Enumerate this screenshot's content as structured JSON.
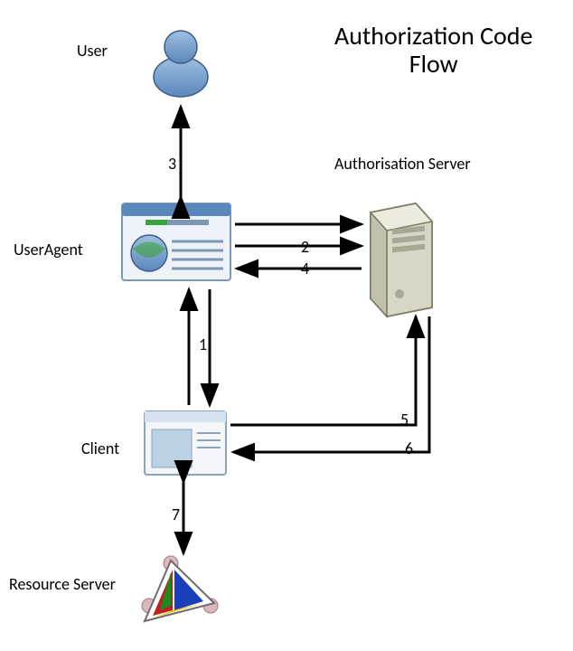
{
  "title": "Authorization Code\nFlow",
  "nodes": {
    "user": {
      "label": "User"
    },
    "userAgent": {
      "label": "UserAgent"
    },
    "client": {
      "label": "Client"
    },
    "resourceServer": {
      "label": "Resource Server"
    },
    "authServer": {
      "label": "Authorisation Server"
    }
  },
  "edges": [
    {
      "id": "1",
      "from": "client",
      "to": "userAgent",
      "bidir": true
    },
    {
      "id": "2",
      "from": "userAgent",
      "to": "authServer",
      "bidir": false,
      "count": 2
    },
    {
      "id": "3",
      "from": "userAgent",
      "to": "user",
      "bidir": true
    },
    {
      "id": "4",
      "from": "authServer",
      "to": "userAgent",
      "bidir": false
    },
    {
      "id": "5",
      "from": "client",
      "to": "authServer",
      "bidir": false
    },
    {
      "id": "6",
      "from": "authServer",
      "to": "client",
      "bidir": false
    },
    {
      "id": "7",
      "from": "client",
      "to": "resourceServer",
      "bidir": true
    }
  ]
}
